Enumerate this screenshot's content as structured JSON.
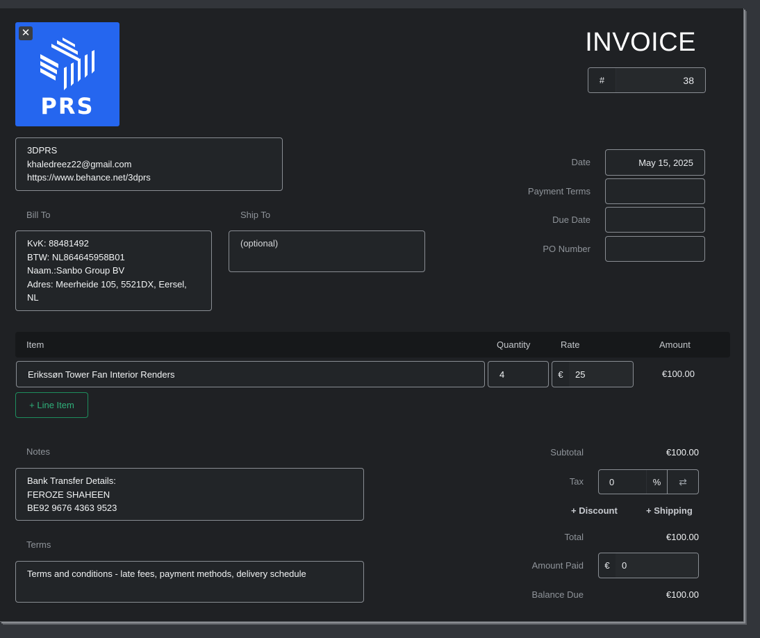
{
  "logo": {
    "text": "PRS",
    "close_icon": "✕"
  },
  "invoice": {
    "title": "INVOICE",
    "number_prefix": "#",
    "number": "38"
  },
  "from": {
    "lines": [
      "3DPRS",
      "khaledreez22@gmail.com",
      "https://www.behance.net/3dprs"
    ]
  },
  "bill_to": {
    "label": "Bill To",
    "lines": [
      "KvK: 88481492",
      "BTW: NL864645958B01",
      "Naam.:Sanbo Group BV",
      "Adres: Meerheide 105, 5521DX, Eersel,",
      "NL"
    ]
  },
  "ship_to": {
    "label": "Ship To",
    "placeholder": "(optional)"
  },
  "meta": {
    "date_label": "Date",
    "date_value": "May 15, 2025",
    "payment_terms_label": "Payment Terms",
    "payment_terms_value": "",
    "due_date_label": "Due Date",
    "due_date_value": "",
    "po_number_label": "PO Number",
    "po_number_value": ""
  },
  "items": {
    "headers": {
      "item": "Item",
      "quantity": "Quantity",
      "rate": "Rate",
      "amount": "Amount"
    },
    "rows": [
      {
        "description": "Erikssøn Tower Fan Interior Renders",
        "quantity": "4",
        "currency": "€",
        "rate": "25",
        "amount": "€100.00"
      }
    ],
    "add_line_label": "+ Line Item"
  },
  "notes": {
    "label": "Notes",
    "lines": [
      "Bank Transfer Details:",
      "FEROZE SHAHEEN",
      "BE92 9676 4363 9523"
    ]
  },
  "terms": {
    "label": "Terms",
    "text": "Terms and conditions - late fees, payment methods, delivery schedule"
  },
  "summary": {
    "subtotal_label": "Subtotal",
    "subtotal_value": "€100.00",
    "tax_label": "Tax",
    "tax_value": "0",
    "tax_unit": "%",
    "swap_icon": "⇄",
    "discount_label": "+ Discount",
    "shipping_label": "+ Shipping",
    "total_label": "Total",
    "total_value": "€100.00",
    "amount_paid_label": "Amount Paid",
    "amount_paid_currency": "€",
    "amount_paid_value": "0",
    "balance_due_label": "Balance Due",
    "balance_due_value": "€100.00"
  },
  "colors": {
    "background": "#1f2124",
    "accent_green": "#2fb07a",
    "logo_blue": "#2566ef"
  }
}
